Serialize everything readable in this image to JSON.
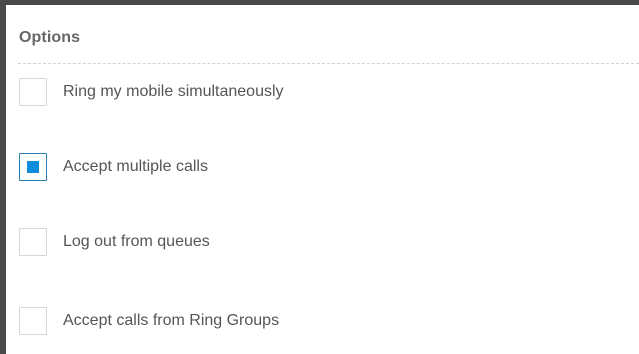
{
  "section": {
    "title": "Options"
  },
  "options": [
    {
      "label": "Ring my mobile simultaneously",
      "checked": false
    },
    {
      "label": "Accept multiple calls",
      "checked": true
    },
    {
      "label": "Log out from queues",
      "checked": false
    },
    {
      "label": "Accept calls from Ring Groups",
      "checked": false
    }
  ],
  "colors": {
    "accent": "#0d8ddc",
    "checked_border": "#2a7db3",
    "text": "#555555",
    "header_text": "#666666",
    "frame": "#4a4a4a"
  }
}
